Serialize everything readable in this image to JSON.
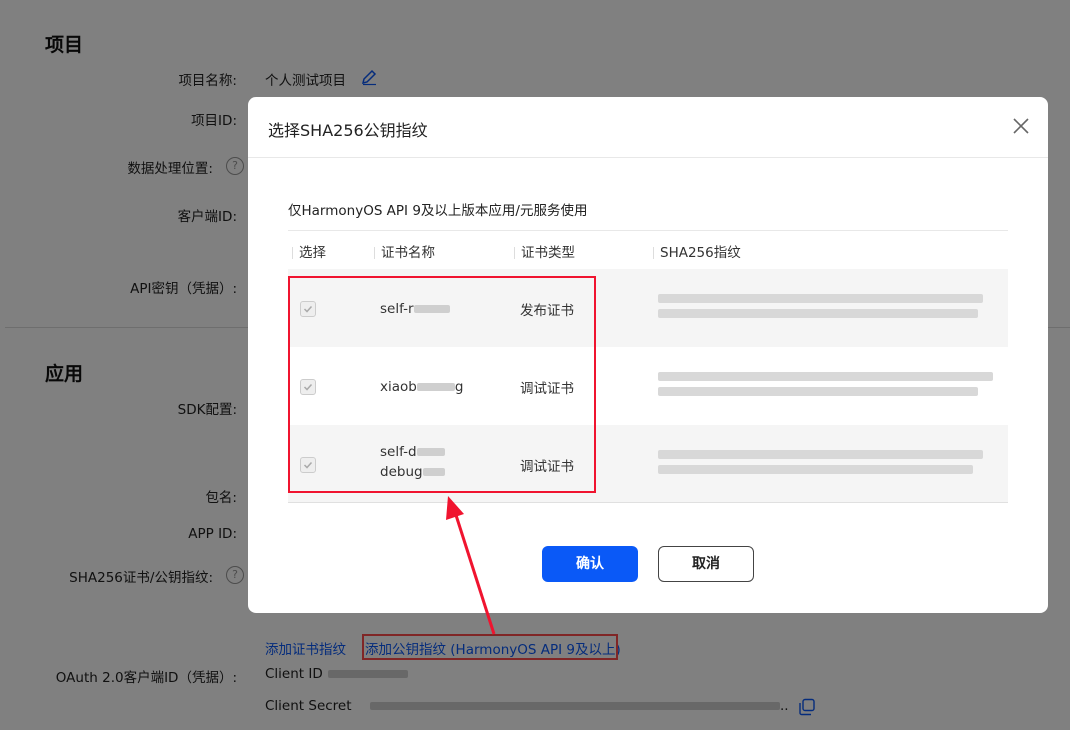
{
  "background": {
    "project_section": "项目",
    "project_name_label": "项目名称:",
    "project_name_value": "个人测试项目",
    "project_id_label": "项目ID:",
    "data_location_label": "数据处理位置:",
    "client_id_label": "客户端ID:",
    "api_key_label": "API密钥（凭据）:",
    "app_section": "应用",
    "sdk_label": "SDK配置:",
    "package_label": "包名:",
    "app_id_label": "APP ID:",
    "sha_label": "SHA256证书/公钥指纹:",
    "add_cert_link": "添加证书指纹",
    "add_key_link": "添加公钥指纹 (HarmonyOS API 9及以上)",
    "oauth_label": "OAuth 2.0客户端ID（凭据）:",
    "client_id_text": "Client ID",
    "client_secret_text": "Client Secret",
    "help_glyph": "?",
    "ellipsis": ".."
  },
  "modal": {
    "title": "选择SHA256公钥指纹",
    "note": "仅HarmonyOS API 9及以上版本应用/元服务使用",
    "columns": [
      "选择",
      "证书名称",
      "证书类型",
      "SHA256指纹"
    ],
    "rows": [
      {
        "name": "self-r",
        "type": "发布证书",
        "checked": true
      },
      {
        "name": "xiaob",
        "name_suffix": "g",
        "type": "调试证书",
        "checked": true
      },
      {
        "name": "self-d",
        "name_line2": "debug",
        "type": "调试证书",
        "checked": true
      }
    ],
    "confirm_label": "确认",
    "cancel_label": "取消"
  },
  "colors": {
    "primary": "#0a59f7",
    "annotation_red": "#f0142f"
  }
}
